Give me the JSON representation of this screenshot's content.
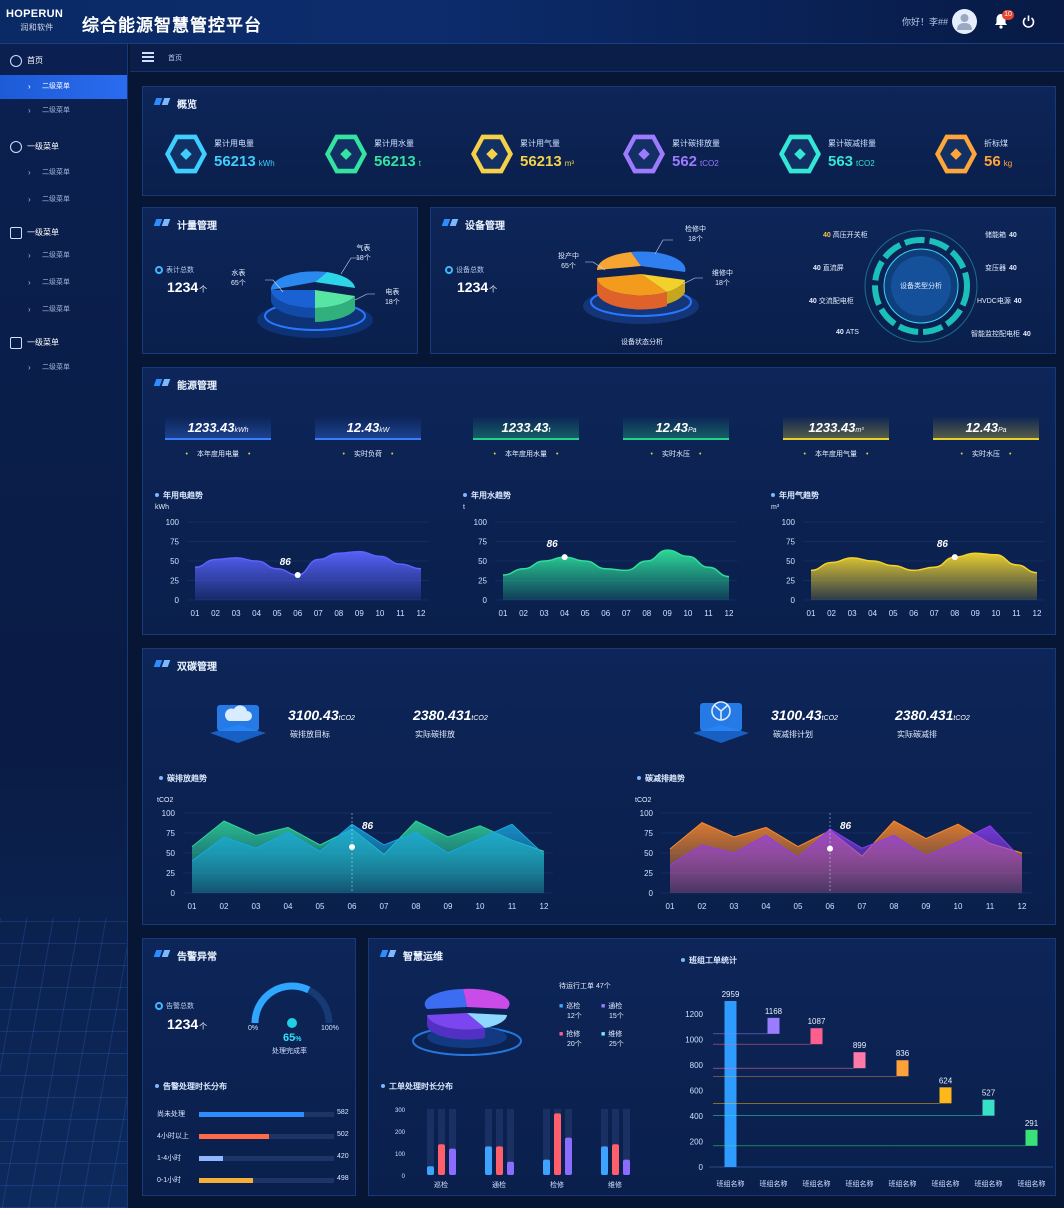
{
  "header": {
    "logo_text": "HOPERUN",
    "logo_sub": "润和软件",
    "title": "综合能源智慧管控平台",
    "greeting": "你好！李##",
    "notification_count": "10"
  },
  "sidebar": {
    "groups": [
      {
        "label": "首页",
        "items": [
          "二级菜单",
          "二级菜单"
        ]
      },
      {
        "label": "一级菜单",
        "items": [
          "二级菜单",
          "二级菜单"
        ]
      },
      {
        "label": "一级菜单",
        "items": [
          "二级菜单",
          "二级菜单",
          "二级菜单"
        ]
      },
      {
        "label": "一级菜单",
        "items": [
          "二级菜单"
        ]
      }
    ]
  },
  "breadcrumb": {
    "current": "首页"
  },
  "overview": {
    "title": "概览",
    "kpis": [
      {
        "label": "累计用电量",
        "value": "56213",
        "unit": "kWh",
        "icon": "lightning-icon",
        "color": "#3ecfff"
      },
      {
        "label": "累计用水量",
        "value": "56213",
        "unit": "t",
        "icon": "water-drop-icon",
        "color": "#35e3a1"
      },
      {
        "label": "累计用气量",
        "value": "56213",
        "unit": "m³",
        "icon": "flame-icon",
        "color": "#f5d14a"
      },
      {
        "label": "累计碳排放量",
        "value": "562",
        "unit": "tCO2",
        "icon": "cloud-icon",
        "color": "#9d7bff"
      },
      {
        "label": "累计碳减排量",
        "value": "563",
        "unit": "tCO2",
        "icon": "leaf-box-icon",
        "color": "#34e6d6"
      },
      {
        "label": "折标煤",
        "value": "56",
        "unit": "kg",
        "icon": "coal-cart-icon",
        "color": "#ffa63a"
      }
    ]
  },
  "metering": {
    "title": "计量管理",
    "total_label": "表计总数",
    "total_value": "1234",
    "total_unit": "个",
    "slices": [
      {
        "name": "气表",
        "value": "18个"
      },
      {
        "name": "水表",
        "value": "65个"
      },
      {
        "name": "电表",
        "value": "18个"
      }
    ]
  },
  "equipment": {
    "title": "设备管理",
    "total_label": "设备总数",
    "total_value": "1234",
    "total_unit": "个",
    "slices": [
      {
        "name": "检修中",
        "value": "18个"
      },
      {
        "name": "投产中",
        "value": "65个"
      },
      {
        "name": "维修中",
        "value": "18个"
      }
    ],
    "pie_caption": "设备状态分析",
    "ring_center": "设备类型分析",
    "types_left": [
      {
        "name": "高压开关柜",
        "value": "40"
      },
      {
        "name": "直流屏",
        "value": "40"
      },
      {
        "name": "交流配电柜",
        "value": "40"
      },
      {
        "name": "ATS",
        "value": "40"
      }
    ],
    "types_right": [
      {
        "name": "储能箱",
        "value": "40"
      },
      {
        "name": "变压器",
        "value": "40"
      },
      {
        "name": "HVDC电源",
        "value": "40"
      },
      {
        "name": "智能监控配电柜",
        "value": "40"
      }
    ]
  },
  "energy": {
    "title": "能源管理",
    "plates": [
      {
        "value": "1233.43",
        "unit": "kWh",
        "label": "本年度用电量",
        "color": "#3a7dff"
      },
      {
        "value": "12.43",
        "unit": "kW",
        "label": "实时负荷",
        "color": "#3a7dff"
      },
      {
        "value": "1233.43",
        "unit": "t",
        "label": "本年度用水量",
        "color": "#27d08a"
      },
      {
        "value": "12.43",
        "unit": "Pa",
        "label": "实时水压",
        "color": "#27d08a"
      },
      {
        "value": "1233.43",
        "unit": "m³",
        "label": "本年度用气量",
        "color": "#e8cf2a"
      },
      {
        "value": "12.43",
        "unit": "Pa",
        "label": "实时水压",
        "color": "#e8cf2a"
      }
    ],
    "charts": [
      {
        "title": "年用电趋势",
        "unit": "kWh",
        "yticks": [
          "100",
          "75",
          "50",
          "25",
          "0"
        ],
        "label": "86",
        "color": "#5a63ff"
      },
      {
        "title": "年用水趋势",
        "unit": "t",
        "yticks": [
          "100",
          "75",
          "50",
          "25",
          "0"
        ],
        "label": "86",
        "color": "#2ee09a"
      },
      {
        "title": "年用气趋势",
        "unit": "m³",
        "yticks": [
          "100",
          "75",
          "50",
          "25",
          "0"
        ],
        "label": "86",
        "color": "#f2d42e"
      }
    ],
    "months": [
      "01",
      "02",
      "03",
      "04",
      "05",
      "06",
      "07",
      "08",
      "09",
      "10",
      "11",
      "12"
    ]
  },
  "carbon": {
    "title": "双碳管理",
    "stats": [
      {
        "value": "3100.43",
        "unit": "tCO2",
        "label": "碳排放目标"
      },
      {
        "value": "2380.431",
        "unit": "tCO2",
        "label": "实际碳排放"
      },
      {
        "value": "3100.43",
        "unit": "tCO2",
        "label": "碳减排计划"
      },
      {
        "value": "2380.431",
        "unit": "tCO2",
        "label": "实际碳减排"
      }
    ],
    "charts": [
      {
        "title": "碳排放趋势",
        "unit": "tCO2",
        "label": "86"
      },
      {
        "title": "碳减排趋势",
        "unit": "tCO2",
        "label": "86"
      }
    ],
    "yticks": [
      "100",
      "75",
      "50",
      "25",
      "0"
    ]
  },
  "alarm": {
    "title": "告警异常",
    "total_label": "告警总数",
    "total_value": "1234",
    "total_unit": "个",
    "gauge_min": "0%",
    "gauge_max": "100%",
    "gauge_value": "65",
    "gauge_unit": "%",
    "gauge_label": "处理完成率",
    "dist_title": "告警处理时长分布",
    "dist": [
      {
        "label": "尚未处理",
        "value": "582",
        "fraction": 0.78,
        "color": "#2f8cff"
      },
      {
        "label": "4小时以上",
        "value": "502",
        "fraction": 0.52,
        "color": "#ff6a4a"
      },
      {
        "label": "1-4小时",
        "value": "420",
        "fraction": 0.18,
        "color": "#8fb6ff"
      },
      {
        "label": "0-1小时",
        "value": "498",
        "fraction": 0.4,
        "color": "#f3b13a"
      }
    ]
  },
  "ops": {
    "title": "智慧运维",
    "pending_label": "待运行工单 47个",
    "legend": [
      {
        "name": "巡检",
        "value": "12个",
        "color": "#3ea3ff"
      },
      {
        "name": "通检",
        "value": "15个",
        "color": "#9b7cff"
      },
      {
        "name": "抢修",
        "value": "20个",
        "color": "#ff5f8f"
      },
      {
        "name": "维修",
        "value": "25个",
        "color": "#7be6ff"
      }
    ],
    "dist_title": "工单处理时长分布",
    "bar_yticks": [
      "300",
      "200",
      "100",
      "0"
    ],
    "bar_groups": [
      "巡检",
      "通检",
      "检修",
      "维修"
    ],
    "team_title": "班组工单统计"
  },
  "chart_data": [
    {
      "type": "line",
      "title": "年用电趋势",
      "ylabel": "kWh",
      "ylim": [
        0,
        100
      ],
      "x": [
        "01",
        "02",
        "03",
        "04",
        "05",
        "06",
        "07",
        "08",
        "09",
        "10",
        "11",
        "12"
      ],
      "values": [
        42,
        52,
        54,
        50,
        40,
        32,
        52,
        60,
        62,
        56,
        46,
        40
      ]
    },
    {
      "type": "line",
      "title": "年用水趋势",
      "ylabel": "t",
      "ylim": [
        0,
        100
      ],
      "x": [
        "01",
        "02",
        "03",
        "04",
        "05",
        "06",
        "07",
        "08",
        "09",
        "10",
        "11",
        "12"
      ],
      "values": [
        32,
        40,
        50,
        55,
        50,
        40,
        38,
        50,
        64,
        56,
        42,
        30
      ]
    },
    {
      "type": "line",
      "title": "年用气趋势",
      "ylabel": "m³",
      "ylim": [
        0,
        100
      ],
      "x": [
        "01",
        "02",
        "03",
        "04",
        "05",
        "06",
        "07",
        "08",
        "09",
        "10",
        "11",
        "12"
      ],
      "values": [
        38,
        48,
        54,
        50,
        44,
        38,
        42,
        55,
        60,
        58,
        45,
        35
      ]
    },
    {
      "type": "area",
      "title": "碳排放趋势",
      "ylabel": "tCO2",
      "ylim": [
        0,
        100
      ],
      "x": [
        "01",
        "02",
        "03",
        "04",
        "05",
        "06",
        "07",
        "08",
        "09",
        "10",
        "11",
        "12"
      ],
      "series": [
        {
          "values": [
            58,
            90,
            72,
            82,
            60,
            80,
            48,
            90,
            70,
            84,
            66,
            52
          ]
        },
        {
          "values": [
            40,
            70,
            56,
            76,
            52,
            86,
            60,
            76,
            50,
            68,
            86,
            48
          ]
        }
      ]
    },
    {
      "type": "area",
      "title": "碳减排趋势",
      "ylabel": "tCO2",
      "ylim": [
        0,
        100
      ],
      "x": [
        "01",
        "02",
        "03",
        "04",
        "05",
        "06",
        "07",
        "08",
        "09",
        "10",
        "11",
        "12"
      ],
      "series": [
        {
          "values": [
            55,
            88,
            70,
            82,
            58,
            78,
            46,
            90,
            68,
            86,
            62,
            50
          ]
        },
        {
          "values": [
            35,
            60,
            50,
            72,
            44,
            80,
            56,
            72,
            46,
            64,
            84,
            42
          ]
        }
      ]
    },
    {
      "type": "bar",
      "title": "工单处理时长分布",
      "ylim": [
        0,
        300
      ],
      "categories": [
        "巡检",
        "通检",
        "检修",
        "维修"
      ],
      "series": [
        {
          "values": [
            40,
            130,
            70,
            130
          ]
        },
        {
          "values": [
            140,
            130,
            280,
            140
          ]
        },
        {
          "values": [
            120,
            60,
            170,
            70
          ]
        }
      ]
    },
    {
      "type": "bar",
      "title": "班组工单统计",
      "ylim": [
        0,
        1300
      ],
      "categories": [
        "班组名称",
        "班组名称",
        "班组名称",
        "班组名称",
        "班组名称",
        "班组名称",
        "班组名称",
        "班组名称"
      ],
      "values": [
        2959,
        1168,
        1087,
        899,
        836,
        624,
        527,
        291
      ],
      "value_labels": [
        "2959",
        "1168",
        "1087",
        "899",
        "836",
        "624",
        "527",
        "291"
      ],
      "yticks": [
        "1200",
        "1000",
        "800",
        "600",
        "400",
        "200",
        "0"
      ],
      "colors": [
        "#2e9bff",
        "#9a7cff",
        "#ff5f8f",
        "#ff7aa8",
        "#ffa13a",
        "#ffb71a",
        "#38e0c6",
        "#3ae07a"
      ]
    }
  ]
}
